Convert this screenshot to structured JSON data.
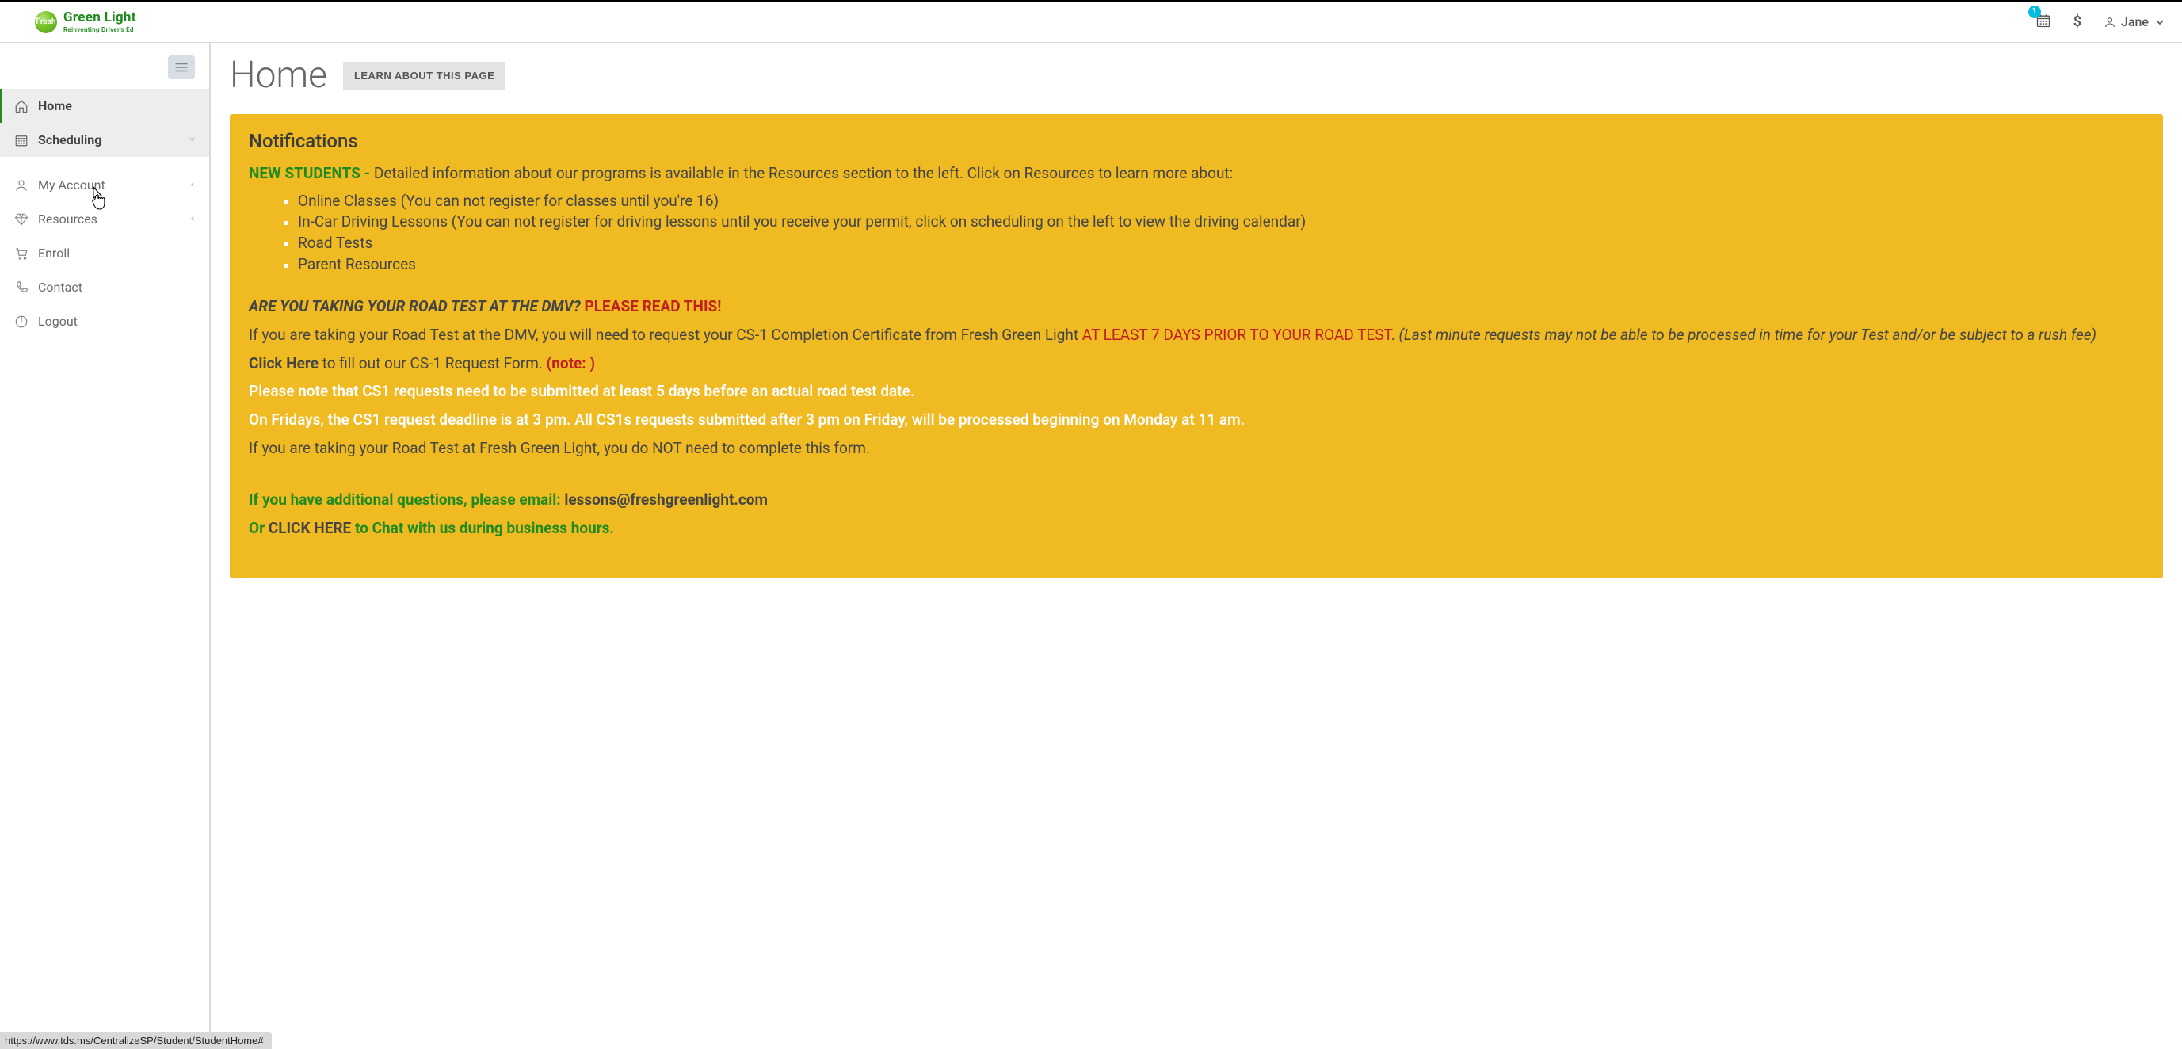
{
  "brand": {
    "logo_text": "Fresh",
    "title": "Green Light",
    "subtitle": "Reinventing Driver's Ed"
  },
  "topbar": {
    "cal_badge": "1",
    "dollar": "$",
    "user_name": "Jane"
  },
  "sidebar": {
    "items": [
      {
        "label": "Home"
      },
      {
        "label": "Scheduling"
      },
      {
        "label": "My Account"
      },
      {
        "label": "Resources"
      },
      {
        "label": "Enroll"
      },
      {
        "label": "Contact"
      },
      {
        "label": "Logout"
      }
    ]
  },
  "page": {
    "title": "Home",
    "learn_btn": "LEARN ABOUT THIS PAGE"
  },
  "notif": {
    "title": "Notifications",
    "new_students_label": "NEW STUDENTS -",
    "new_students_body": " Detailed information about our programs is available in the Resources section to the left.  Click on Resources to learn more about:",
    "bullets": [
      "Online Classes (You can not register for classes until you're 16)",
      "In-Car Driving Lessons (You can not register for driving lessons until you receive your permit, click on scheduling on the left to view the driving calendar)",
      "Road Tests",
      "Parent Resources"
    ],
    "dmv_q": "ARE YOU TAKING YOUR ROAD TEST AT THE DMV?  ",
    "dmv_read": "PLEASE READ THIS!",
    "cs1_a": "If you are taking your Road Test at the DMV, you will need to request your CS-1 Completion Certificate from Fresh Green Light ",
    "cs1_b": "AT LEAST 7 DAYS PRIOR TO YOUR ROAD TEST",
    "cs1_c": ". ",
    "cs1_d": "(Last minute requests may not be able to be processed in time for your Test and/or be subject to a rush fee)",
    "click_here": "Click Here",
    "click_here_rest": " to fill out our CS-1 Request Form.  ",
    "note": "(note:  )",
    "white1": "Please note that CS1 requests need to be submitted at least 5 days before an actual road test date.",
    "white2": "On Fridays, the CS1 request deadline is at 3 pm. All CS1s requests submitted after 3 pm on Friday, will be processed beginning on Monday at 11 am.",
    "fgl_test": "If you are taking your Road Test at Fresh Green Light, you do NOT need to complete this form.",
    "email_pre": "If you have additional questions, please email: ",
    "email": "lessons@freshgreenlight.com",
    "or": "Or ",
    "click_here2": "CLICK HERE",
    "chat_rest": " to Chat with us during business hours."
  },
  "status_url": "https://www.tds.ms/CentralizeSP/Student/StudentHome#"
}
